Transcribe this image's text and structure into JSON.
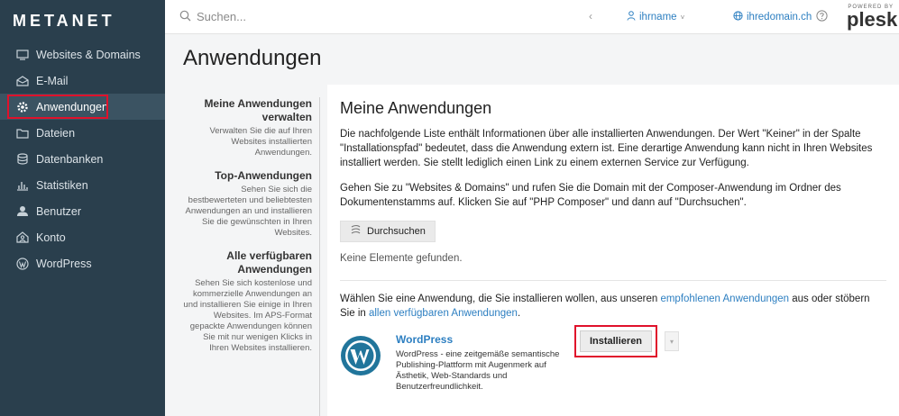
{
  "brand": {
    "logo": "METANET"
  },
  "sidebar": {
    "items": [
      {
        "label": "Websites & Domains",
        "icon": "monitor-icon"
      },
      {
        "label": "E-Mail",
        "icon": "mail-icon"
      },
      {
        "label": "Anwendungen",
        "icon": "gear-icon"
      },
      {
        "label": "Dateien",
        "icon": "folder-icon"
      },
      {
        "label": "Datenbanken",
        "icon": "database-icon"
      },
      {
        "label": "Statistiken",
        "icon": "bar-chart-icon"
      },
      {
        "label": "Benutzer",
        "icon": "user-icon"
      },
      {
        "label": "Konto",
        "icon": "account-icon"
      },
      {
        "label": "WordPress",
        "icon": "wordpress-icon"
      }
    ],
    "active_index": 2
  },
  "topbar": {
    "search_placeholder": "Suchen...",
    "user": "ihrname",
    "domain": "ihredomain.ch",
    "powered_by": "POWERED BY",
    "brand": "plesk"
  },
  "page": {
    "title": "Anwendungen"
  },
  "side_panel": [
    {
      "heading": "Meine Anwendungen verwalten",
      "desc": "Verwalten Sie die auf Ihren Websites installierten Anwendungen."
    },
    {
      "heading": "Top-Anwendungen",
      "desc": "Sehen Sie sich die bestbewerteten und beliebtesten Anwendungen an und installieren Sie die gewünschten in Ihren Websites."
    },
    {
      "heading": "Alle verfügbaren Anwendungen",
      "desc": "Sehen Sie sich kostenlose und kommerzielle Anwendungen an und installieren Sie einige in Ihren Websites. Im APS-Format gepackte Anwendungen können Sie mit nur wenigen Klicks in Ihren Websites installieren."
    }
  ],
  "content": {
    "heading": "Meine Anwendungen",
    "para1": "Die nachfolgende Liste enthält Informationen über alle installierten Anwendungen. Der Wert \"Keiner\" in der Spalte \"Installationspfad\" bedeutet, dass die Anwendung extern ist. Eine derartige Anwendung kann nicht in Ihren Websites installiert werden. Sie stellt lediglich einen Link zu einem externen Service zur Verfügung.",
    "para2": "Gehen Sie zu \"Websites & Domains\" und rufen Sie die Domain mit der Composer-Anwendung im Ordner des Dokumentenstamms auf. Klicken Sie auf \"PHP Composer\" und dann auf \"Durchsuchen\".",
    "browse_label": "Durchsuchen",
    "empty": "Keine Elemente gefunden.",
    "choose_pre": "Wählen Sie eine Anwendung, die Sie installieren wollen, aus unseren ",
    "choose_link1": "empfohlenen Anwendungen",
    "choose_mid": " aus oder stöbern Sie in ",
    "choose_link2": "allen verfügbaren Anwendungen",
    "choose_post": ".",
    "app": {
      "name": "WordPress",
      "desc": "WordPress - eine zeitgemäße semantische Publishing-Plattform mit Augenmerk auf Ästhetik, Web-Standards und Benutzerfreundlichkeit.",
      "install_label": "Installieren",
      "caret": "▾"
    }
  },
  "colors": {
    "sidebar": "#2a3f4d",
    "accent": "#2d7fc1",
    "highlight": "#e0112b"
  }
}
